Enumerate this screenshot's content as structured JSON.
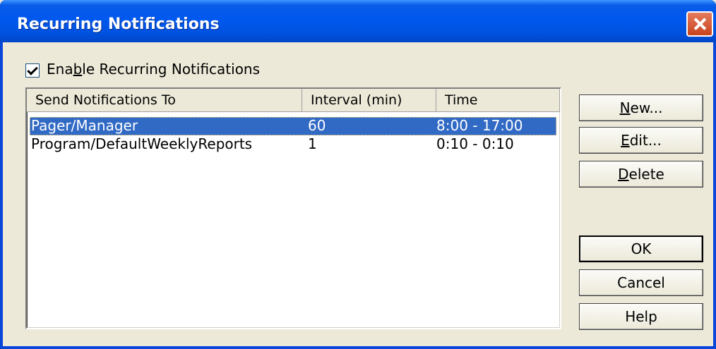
{
  "window": {
    "title": "Recurring Notifications"
  },
  "checkbox": {
    "label_pre": "Ena",
    "label_u": "b",
    "label_post": "le Recurring Notifications",
    "checked": true
  },
  "list": {
    "columns": [
      "Send Notifications To",
      "Interval (min)",
      "Time"
    ],
    "rows": [
      {
        "to": "Pager/Manager",
        "interval": "60",
        "time": "8:00 - 17:00",
        "selected": true
      },
      {
        "to": "Program/DefaultWeeklyReports",
        "interval": "1",
        "time": "0:10 - 0:10",
        "selected": false
      }
    ]
  },
  "buttons": {
    "new": {
      "u": "N",
      "rest": "ew..."
    },
    "edit": {
      "u": "E",
      "rest": "dit..."
    },
    "delete": {
      "u": "D",
      "rest": "elete"
    },
    "ok": "OK",
    "cancel": "Cancel",
    "help": "Help"
  },
  "colors": {
    "titlebar": "#0058ee",
    "selection": "#316ac5",
    "dialog_bg": "#ece9d8"
  }
}
